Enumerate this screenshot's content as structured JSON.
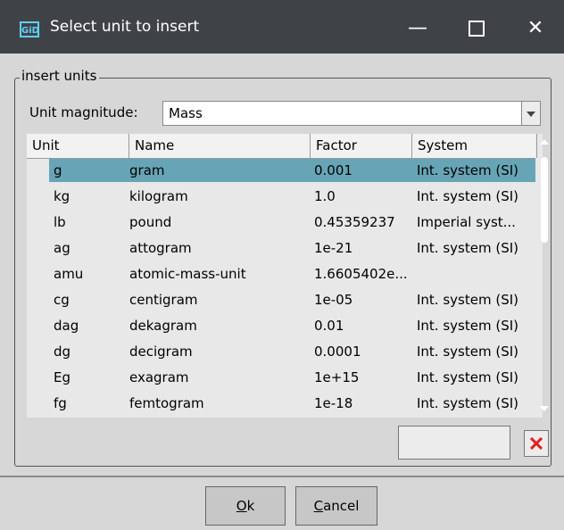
{
  "window": {
    "app_icon_text": "GiD",
    "title": "Select unit to insert"
  },
  "group": {
    "label": "insert units"
  },
  "magnitude": {
    "label": "Unit magnitude:",
    "value": "Mass"
  },
  "table": {
    "columns": [
      "Unit",
      "Name",
      "Factor",
      "System"
    ],
    "selected_index": 0,
    "rows": [
      {
        "unit": "g",
        "name": "gram",
        "factor": "0.001",
        "system": "Int. system (SI)"
      },
      {
        "unit": "kg",
        "name": "kilogram",
        "factor": "1.0",
        "system": "Int. system (SI)"
      },
      {
        "unit": "lb",
        "name": "pound",
        "factor": "0.45359237",
        "system": "Imperial syst..."
      },
      {
        "unit": "ag",
        "name": "attogram",
        "factor": "1e-21",
        "system": "Int. system (SI)"
      },
      {
        "unit": "amu",
        "name": "atomic-mass-unit",
        "factor": "1.6605402e...",
        "system": ""
      },
      {
        "unit": "cg",
        "name": "centigram",
        "factor": "1e-05",
        "system": "Int. system (SI)"
      },
      {
        "unit": "dag",
        "name": "dekagram",
        "factor": "0.01",
        "system": "Int. system (SI)"
      },
      {
        "unit": "dg",
        "name": "decigram",
        "factor": "0.0001",
        "system": "Int. system (SI)"
      },
      {
        "unit": "Eg",
        "name": "exagram",
        "factor": "1e+15",
        "system": "Int. system (SI)"
      },
      {
        "unit": "fg",
        "name": "femtogram",
        "factor": "1e-18",
        "system": "Int. system (SI)"
      }
    ]
  },
  "buttons": {
    "ok_mnemonic": "O",
    "ok_rest": "k",
    "cancel_mnemonic": "C",
    "cancel_rest": "ancel"
  },
  "colors": {
    "titlebar": "#3f4347",
    "selection": "#67a5b6",
    "clear_icon": "#e02020"
  }
}
